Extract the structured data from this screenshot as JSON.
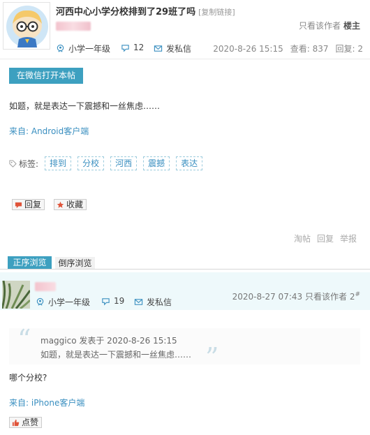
{
  "thread": {
    "title": "河西中心小学分校排到了29班了吗",
    "copy_link": "[复制链接]",
    "only_author": "只看该作者",
    "floor_label": "楼主",
    "author_meta": {
      "level": "小学一年级",
      "posts_count": "12",
      "message": "发私信"
    },
    "datetime": "2020-8-26 15:15",
    "views": "查看: 837",
    "replies": "回复: 2",
    "wechat_button": "在微信打开本帖",
    "body": "如题，就是表达一下震撼和一丝焦虑……",
    "from": "来自: Android客户端",
    "tags_label": "标签:",
    "tags": [
      "排到",
      "分校",
      "河西",
      "震撼",
      "表达"
    ],
    "reply_button": "回复",
    "favorite_button": "收藏",
    "footer_actions": [
      "淘帖",
      "回复",
      "举报"
    ]
  },
  "sort_tabs": {
    "asc": "正序浏览",
    "desc": "倒序浏览"
  },
  "reply": {
    "author_meta": {
      "level": "小学一年级",
      "posts_count": "19",
      "message": "发私信"
    },
    "datetime": "2020-8-27 07:43",
    "only_author": "只看该作者",
    "floor": "2",
    "floor_mark": "#",
    "quote_header": "maggico 发表于 2020-8-26 15:15",
    "quote_text": "如题，就是表达一下震撼和一丝焦虑……",
    "body": "哪个分校?",
    "from": "来自: iPhone客户端",
    "like_button": "点赞"
  },
  "colors": {
    "accent": "#3da0c0",
    "link": "#3a8fc0",
    "reply_header_bg": "#eef9fb"
  },
  "icons": {
    "level": "user-badge-icon",
    "posts": "chat-bubble-icon",
    "message": "envelope-icon",
    "tag": "tag-icon",
    "reply": "speech-bubble-icon",
    "favorite": "star-icon",
    "like": "thumbs-up-icon"
  }
}
